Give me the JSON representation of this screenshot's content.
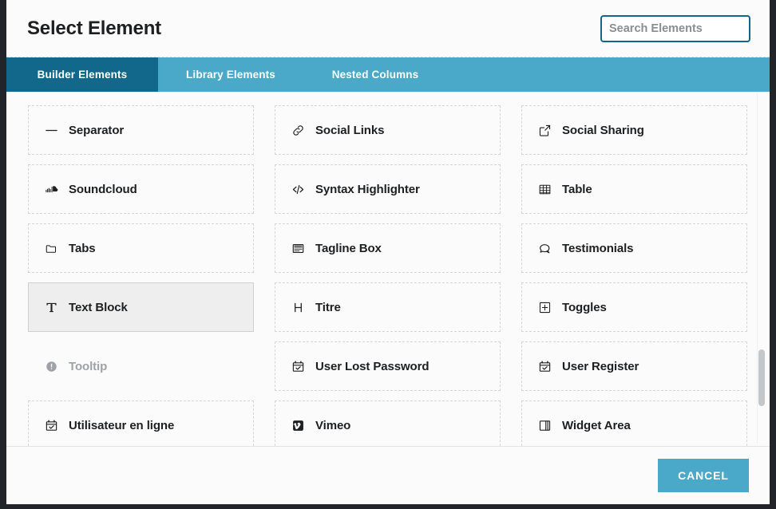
{
  "header": {
    "title": "Select Element",
    "search": {
      "value": "",
      "placeholder": "Search Elements",
      "focused": true,
      "focus_border_color": "#15658a"
    }
  },
  "tabs": {
    "active_index": 0,
    "active_color": "#12688a",
    "bar_color": "#4aa8c9",
    "items": [
      {
        "label": "Builder Elements"
      },
      {
        "label": "Library Elements"
      },
      {
        "label": "Nested Columns"
      }
    ]
  },
  "elements": [
    {
      "label": "Separator",
      "icon": "minus-icon",
      "state": "normal"
    },
    {
      "label": "Social Links",
      "icon": "link-chain-icon",
      "state": "normal"
    },
    {
      "label": "Social Sharing",
      "icon": "external-link-icon",
      "state": "normal"
    },
    {
      "label": "Soundcloud",
      "icon": "soundcloud-icon",
      "state": "normal"
    },
    {
      "label": "Syntax Highlighter",
      "icon": "code-brackets-icon",
      "state": "normal"
    },
    {
      "label": "Table",
      "icon": "table-grid-icon",
      "state": "normal"
    },
    {
      "label": "Tabs",
      "icon": "folder-tabs-icon",
      "state": "normal"
    },
    {
      "label": "Tagline Box",
      "icon": "tagline-box-icon",
      "state": "normal"
    },
    {
      "label": "Testimonials",
      "icon": "speech-bubble-icon",
      "state": "normal"
    },
    {
      "label": "Text Block",
      "icon": "text-t-icon",
      "state": "hover"
    },
    {
      "label": "Titre",
      "icon": "heading-h-icon",
      "state": "normal"
    },
    {
      "label": "Toggles",
      "icon": "plus-box-icon",
      "state": "normal"
    },
    {
      "label": "Tooltip",
      "icon": "info-circle-icon",
      "state": "disabled"
    },
    {
      "label": "User Lost Password",
      "icon": "calendar-check-icon",
      "state": "normal"
    },
    {
      "label": "User Register",
      "icon": "calendar-check-icon",
      "state": "normal"
    },
    {
      "label": "Utilisateur en ligne",
      "icon": "calendar-check-icon",
      "state": "normal"
    },
    {
      "label": "Vimeo",
      "icon": "vimeo-icon",
      "state": "normal"
    },
    {
      "label": "Widget Area",
      "icon": "widget-area-icon",
      "state": "normal"
    }
  ],
  "scrollbar": {
    "thumb_top_percent": 73,
    "thumb_height_percent": 16
  },
  "footer": {
    "cancel_label": "CANCEL",
    "cancel_color": "#4aa8c9"
  }
}
